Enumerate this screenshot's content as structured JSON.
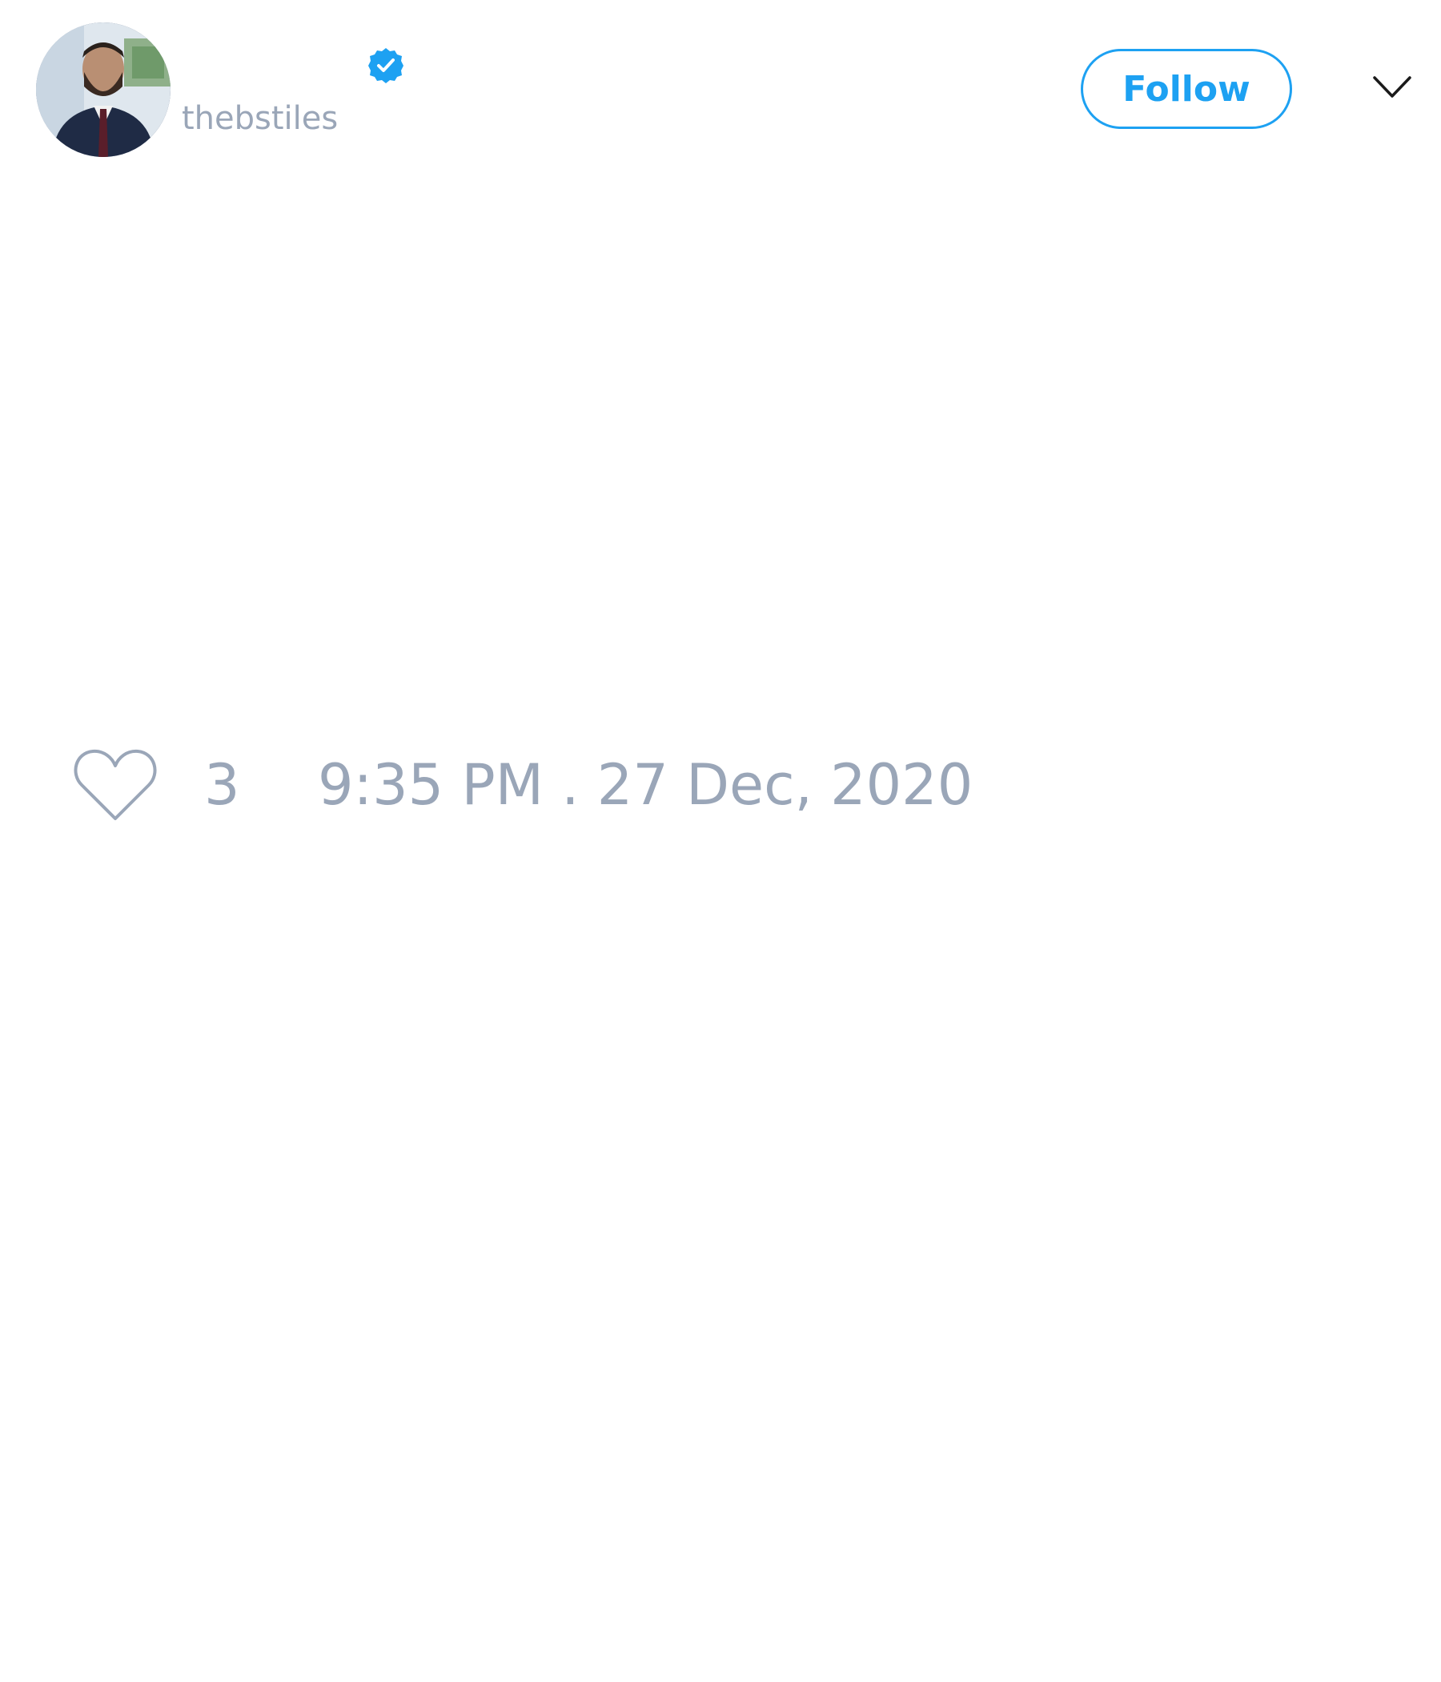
{
  "tweet": {
    "author": {
      "handle": "thebstiles",
      "avatar": "profile-photo-man-suit",
      "verified_icon": "verified-badge-icon"
    },
    "follow_label": "Follow",
    "menu_icon": "chevron-down-icon",
    "likes": {
      "icon": "heart-icon",
      "count": "3"
    },
    "timestamp": "9:35 PM . 27 Dec, 2020"
  },
  "colors": {
    "accent": "#1da1f2",
    "muted_text": "#9aa6b8",
    "background": "#ffffff"
  }
}
